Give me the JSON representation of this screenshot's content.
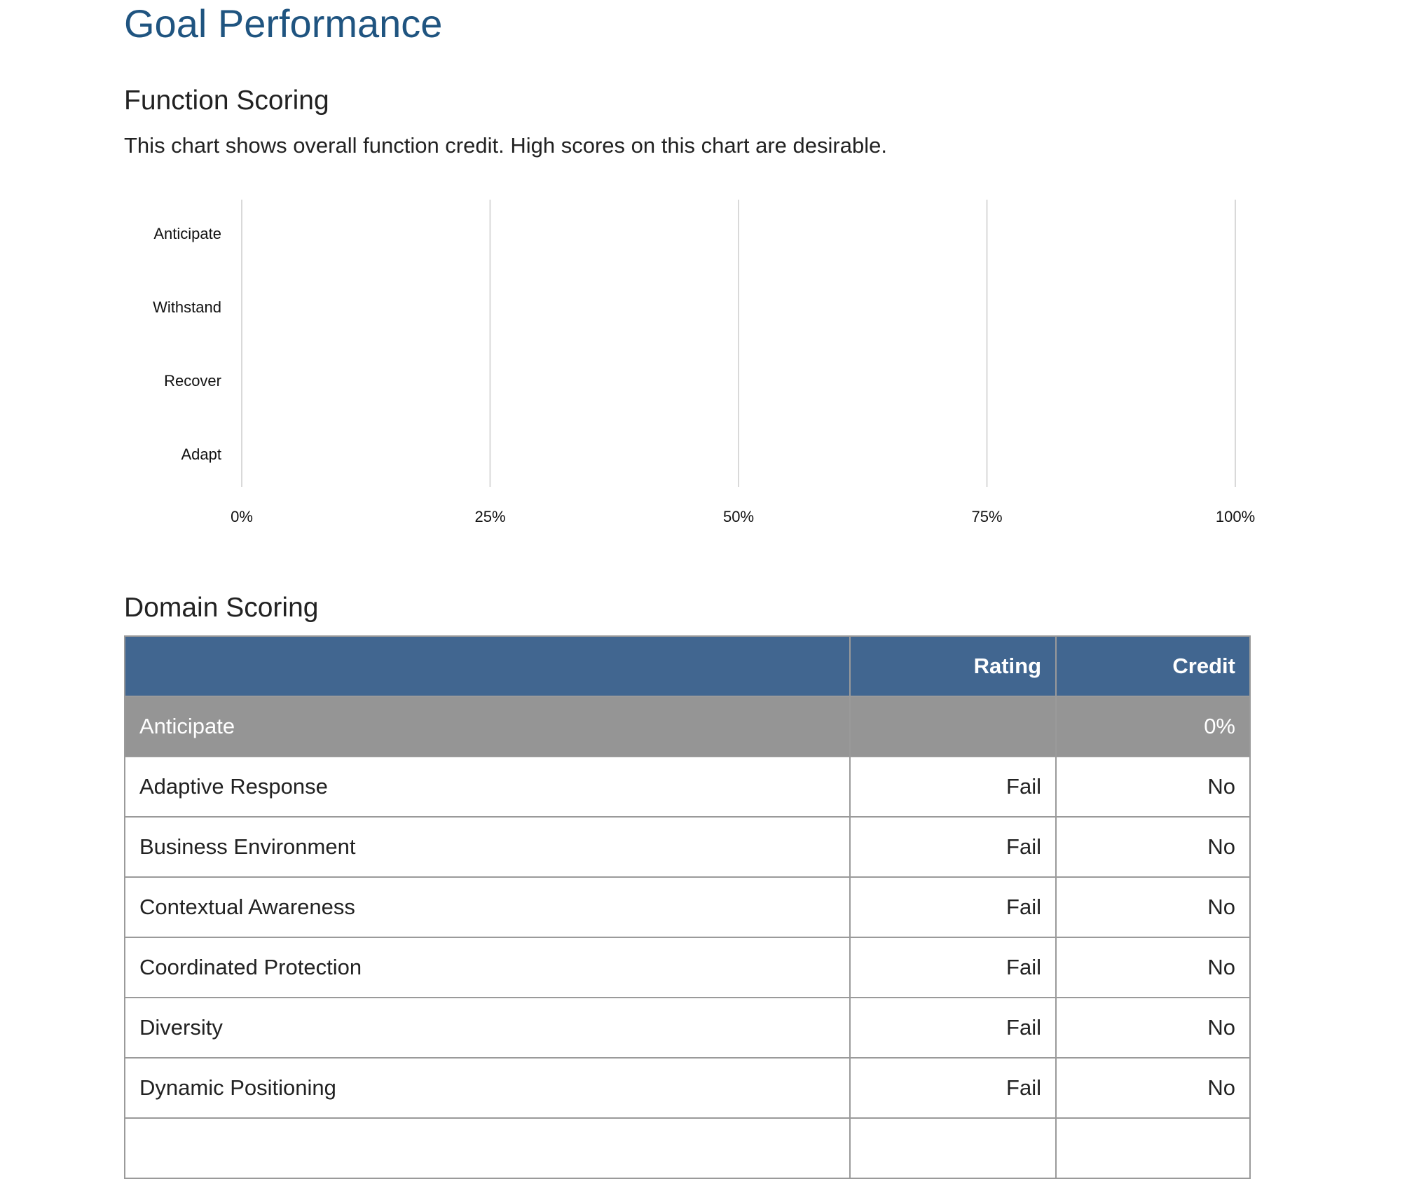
{
  "page": {
    "title": "Goal Performance"
  },
  "function_scoring": {
    "title": "Function Scoring",
    "description": "This chart shows overall function credit. High scores on this chart are desirable."
  },
  "chart_data": {
    "type": "bar",
    "orientation": "horizontal",
    "categories": [
      "Anticipate",
      "Withstand",
      "Recover",
      "Adapt"
    ],
    "values": [
      0,
      0,
      0,
      0
    ],
    "xlim": [
      0,
      100
    ],
    "xticks": [
      "0%",
      "25%",
      "50%",
      "75%",
      "100%"
    ],
    "grid": true,
    "bar_color": "#416690"
  },
  "domain_scoring": {
    "title": "Domain Scoring",
    "columns": [
      "",
      "Rating",
      "Credit"
    ],
    "group": {
      "name": "Anticipate",
      "rating": "",
      "credit": "0%"
    },
    "rows": [
      {
        "name": "Adaptive Response",
        "rating": "Fail",
        "credit": "No"
      },
      {
        "name": "Business Environment",
        "rating": "Fail",
        "credit": "No"
      },
      {
        "name": "Contextual Awareness",
        "rating": "Fail",
        "credit": "No"
      },
      {
        "name": "Coordinated Protection",
        "rating": "Fail",
        "credit": "No"
      },
      {
        "name": "Diversity",
        "rating": "Fail",
        "credit": "No"
      },
      {
        "name": "Dynamic Positioning",
        "rating": "Fail",
        "credit": "No"
      },
      {
        "name": "",
        "rating": "",
        "credit": ""
      }
    ]
  },
  "colors": {
    "title": "#1f5480",
    "table_header": "#416690",
    "group_row": "#959595",
    "border": "#9a9a9a",
    "gridline": "#d9d9d9"
  }
}
